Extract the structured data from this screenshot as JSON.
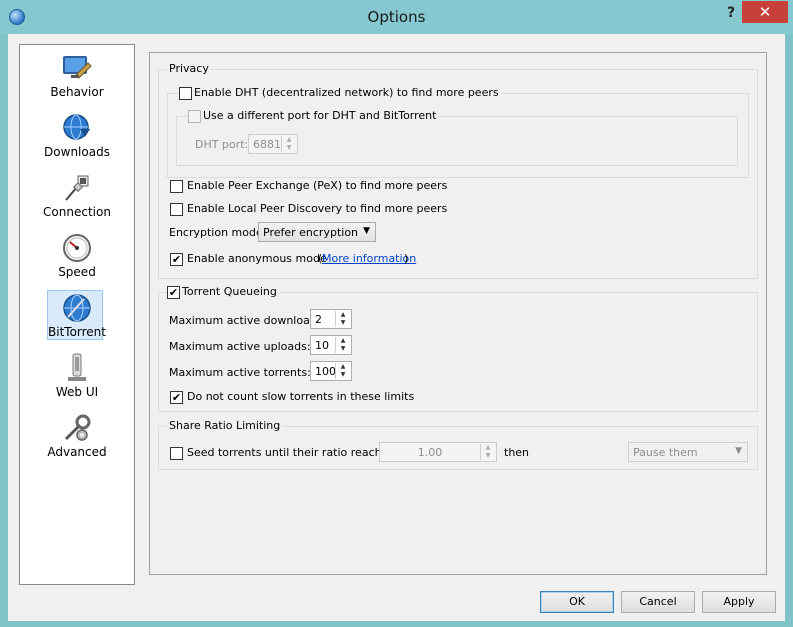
{
  "window": {
    "title": "Options",
    "help": "?",
    "close": "✕"
  },
  "sidebar": {
    "items": [
      {
        "label": "Behavior",
        "icon": "behavior-icon"
      },
      {
        "label": "Downloads",
        "icon": "downloads-globe-icon"
      },
      {
        "label": "Connection",
        "icon": "connection-plug-icon"
      },
      {
        "label": "Speed",
        "icon": "speed-gauge-icon"
      },
      {
        "label": "BitTorrent",
        "icon": "bittorrent-globe-icon",
        "selected": true
      },
      {
        "label": "Web UI",
        "icon": "web-ui-icon"
      },
      {
        "label": "Advanced",
        "icon": "advanced-tools-icon"
      }
    ]
  },
  "privacy": {
    "title": "Privacy",
    "dht": {
      "label": "Enable DHT (decentralized network) to find more peers",
      "checked": false
    },
    "dht_diff_port": {
      "label": "Use a different port for DHT and BitTorrent",
      "checked": false
    },
    "dht_port": {
      "label": "DHT port:",
      "value": "6881"
    },
    "pex": {
      "label": "Enable Peer Exchange (PeX) to find more peers",
      "checked": false
    },
    "lpd": {
      "label": "Enable Local Peer Discovery to find more peers",
      "checked": false
    },
    "encryption": {
      "label": "Encryption mode:",
      "value": "Prefer encryption"
    },
    "anon": {
      "label": "Enable anonymous mode",
      "checked": true,
      "paren_open": "(",
      "link": "More information",
      "paren_close": ")"
    }
  },
  "queueing": {
    "title": "Torrent Queueing",
    "checked": true,
    "max_downloads": {
      "label": "Maximum active downloads:",
      "value": "2"
    },
    "max_uploads": {
      "label": "Maximum active uploads:",
      "value": "10"
    },
    "max_torrents": {
      "label": "Maximum active torrents:",
      "value": "100"
    },
    "slow": {
      "label": "Do not count slow torrents in these limits",
      "checked": true
    }
  },
  "ratio": {
    "title": "Share Ratio Limiting",
    "seed": {
      "label": "Seed torrents until their ratio reaches",
      "checked": false
    },
    "value": "1.00",
    "then": "then",
    "action": "Pause them"
  },
  "buttons": {
    "ok": "OK",
    "cancel": "Cancel",
    "apply": "Apply"
  },
  "glyphs": {
    "check": "✔",
    "up": "▲",
    "down": "▼",
    "combo": "▼"
  }
}
